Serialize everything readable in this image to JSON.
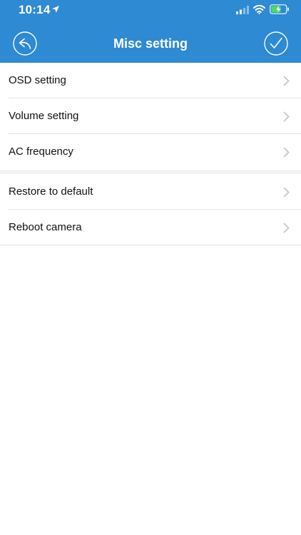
{
  "status_bar": {
    "time": "10:14"
  },
  "nav": {
    "title": "Misc setting",
    "back_icon": "back-arrow-icon",
    "confirm_icon": "checkmark-icon"
  },
  "groups": [
    {
      "items": [
        {
          "label": "OSD setting"
        },
        {
          "label": "Volume setting"
        },
        {
          "label": "AC frequency"
        }
      ]
    },
    {
      "items": [
        {
          "label": "Restore to default"
        },
        {
          "label": "Reboot camera"
        }
      ]
    }
  ],
  "colors": {
    "header": "#2e8ad3",
    "battery_fill": "#4cd964",
    "chevron": "#c7c7cc"
  }
}
